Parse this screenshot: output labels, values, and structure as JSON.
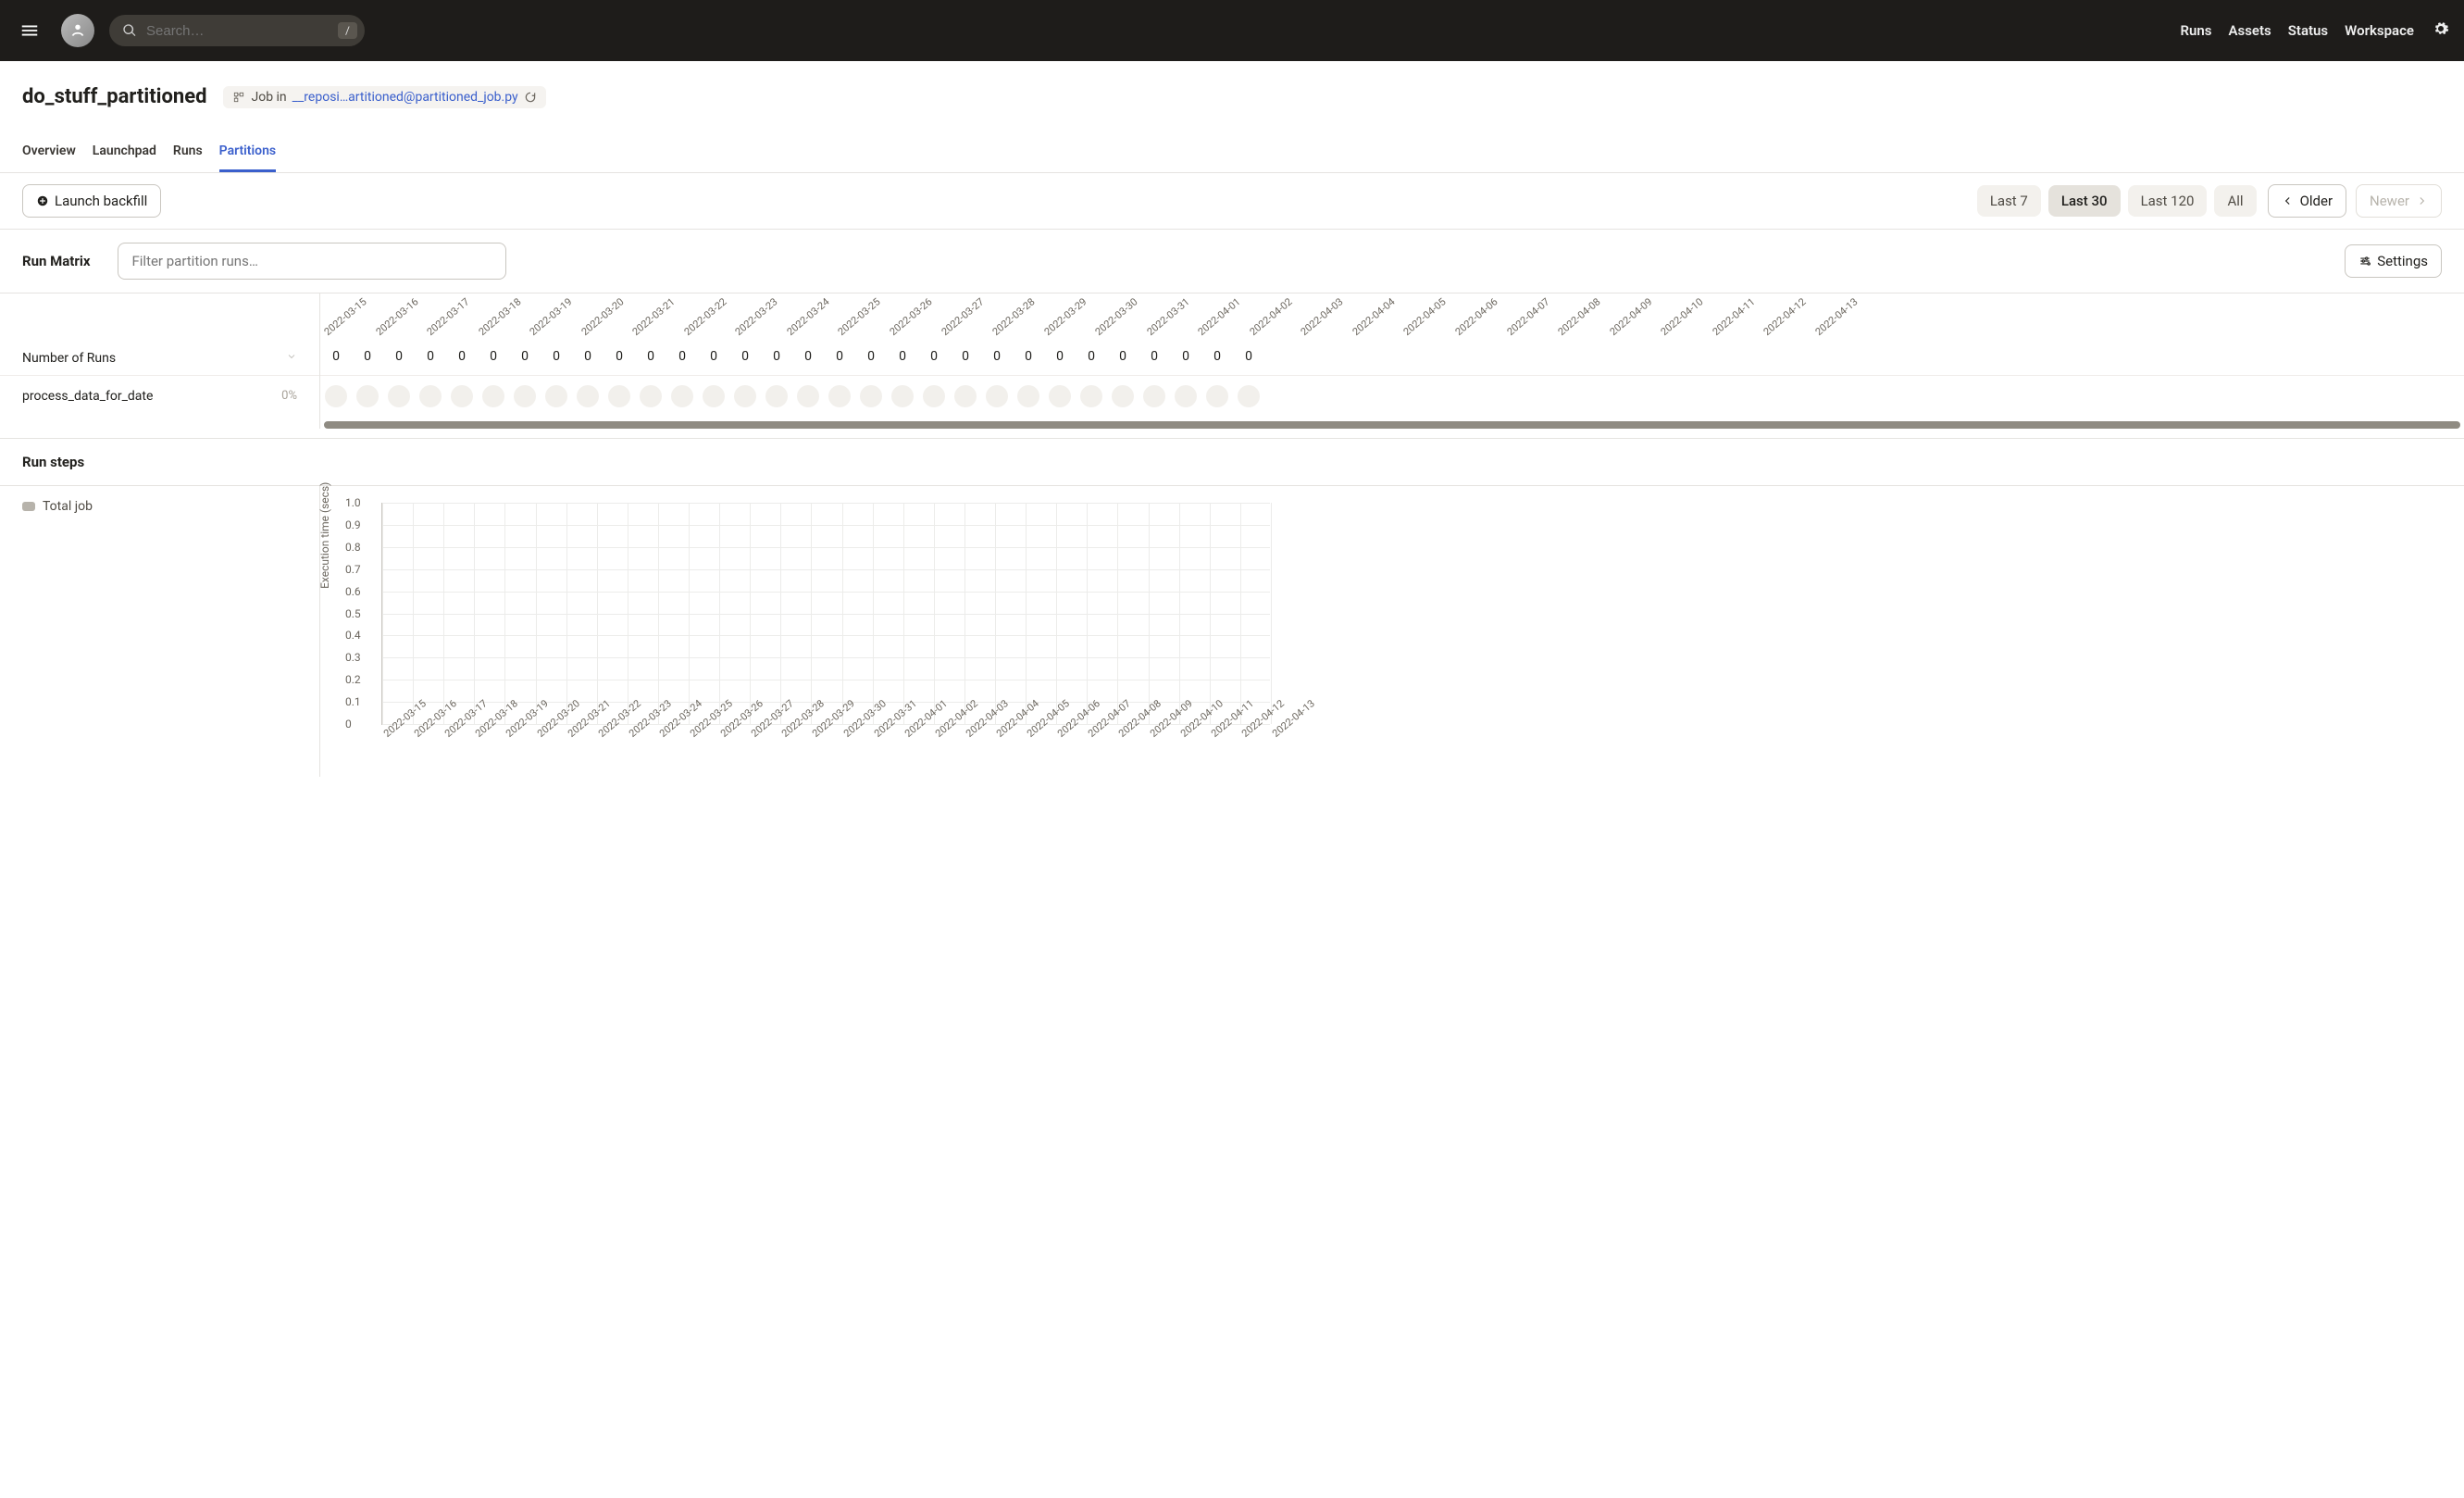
{
  "topbar": {
    "search_placeholder": "Search…",
    "search_shortcut": "/",
    "links": [
      "Runs",
      "Assets",
      "Status",
      "Workspace"
    ]
  },
  "header": {
    "title": "do_stuff_partitioned",
    "job_prefix": "Job in",
    "job_link": "__reposi…artitioned@partitioned_job.py",
    "tabs": [
      "Overview",
      "Launchpad",
      "Runs",
      "Partitions"
    ],
    "active_tab": 3
  },
  "controls": {
    "launch_backfill": "Launch backfill",
    "ranges": [
      "Last 7",
      "Last 30",
      "Last 120",
      "All"
    ],
    "active_range": 1,
    "older": "Older",
    "newer": "Newer"
  },
  "matrix": {
    "title": "Run Matrix",
    "filter_placeholder": "Filter partition runs…",
    "settings": "Settings",
    "num_runs_label": "Number of Runs",
    "row_name": "process_data_for_date",
    "row_pct": "0%",
    "dates": [
      "2022-03-15",
      "2022-03-16",
      "2022-03-17",
      "2022-03-18",
      "2022-03-19",
      "2022-03-20",
      "2022-03-21",
      "2022-03-22",
      "2022-03-23",
      "2022-03-24",
      "2022-03-25",
      "2022-03-26",
      "2022-03-27",
      "2022-03-28",
      "2022-03-29",
      "2022-03-30",
      "2022-03-31",
      "2022-04-01",
      "2022-04-02",
      "2022-04-03",
      "2022-04-04",
      "2022-04-05",
      "2022-04-06",
      "2022-04-07",
      "2022-04-08",
      "2022-04-09",
      "2022-04-10",
      "2022-04-11",
      "2022-04-12",
      "2022-04-13"
    ],
    "counts": [
      0,
      0,
      0,
      0,
      0,
      0,
      0,
      0,
      0,
      0,
      0,
      0,
      0,
      0,
      0,
      0,
      0,
      0,
      0,
      0,
      0,
      0,
      0,
      0,
      0,
      0,
      0,
      0,
      0,
      0
    ]
  },
  "runsteps": {
    "title": "Run steps",
    "total_job": "Total job"
  },
  "chart_data": {
    "type": "line",
    "title": "",
    "xlabel": "",
    "ylabel": "Execution time (secs)",
    "ylim": [
      0,
      1.0
    ],
    "yticks": [
      0,
      0.1,
      0.2,
      0.3,
      0.4,
      0.5,
      0.6,
      0.7,
      0.8,
      0.9,
      1.0
    ],
    "categories": [
      "2022-03-15",
      "2022-03-16",
      "2022-03-17",
      "2022-03-18",
      "2022-03-19",
      "2022-03-20",
      "2022-03-21",
      "2022-03-22",
      "2022-03-23",
      "2022-03-24",
      "2022-03-25",
      "2022-03-26",
      "2022-03-27",
      "2022-03-28",
      "2022-03-29",
      "2022-03-30",
      "2022-03-31",
      "2022-04-01",
      "2022-04-02",
      "2022-04-03",
      "2022-04-04",
      "2022-04-05",
      "2022-04-06",
      "2022-04-07",
      "2022-04-08",
      "2022-04-09",
      "2022-04-10",
      "2022-04-11",
      "2022-04-12",
      "2022-04-13"
    ],
    "series": [
      {
        "name": "Total job",
        "values": []
      }
    ]
  }
}
